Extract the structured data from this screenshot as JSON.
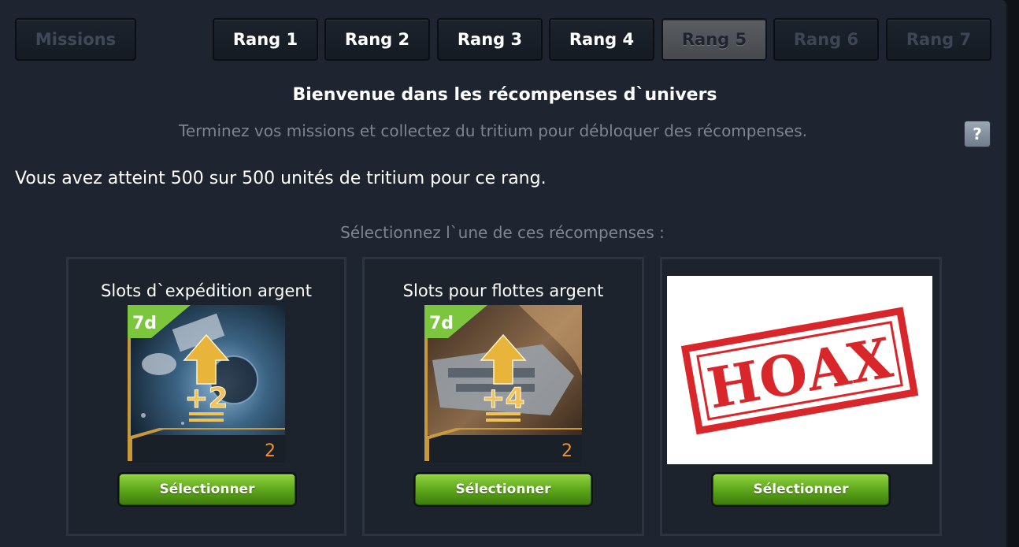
{
  "tabs": {
    "missions": "Missions",
    "ranks": [
      "Rang 1",
      "Rang 2",
      "Rang 3",
      "Rang 4",
      "Rang 5",
      "Rang 6",
      "Rang 7"
    ]
  },
  "header": {
    "title": "Bienvenue dans les récompenses d`univers",
    "subtitle": "Terminez vos missions et collectez du tritium pour débloquer des récompenses.",
    "help": "?"
  },
  "progress_text": "Vous avez atteint 500 sur 500 unités de tritium pour ce rang.",
  "select_prompt": "Sélectionnez l`une de ces récompenses :",
  "rewards": [
    {
      "title": "Slots d`expédition argent",
      "duration": "7d",
      "bonus": "+2",
      "count": "2",
      "button": "Sélectionner"
    },
    {
      "title": "Slots pour flottes argent",
      "duration": "7d",
      "bonus": "+4",
      "count": "2",
      "button": "Sélectionner"
    },
    {
      "title": "",
      "stamp": "HOAX",
      "button": "Sélectionner"
    }
  ]
}
